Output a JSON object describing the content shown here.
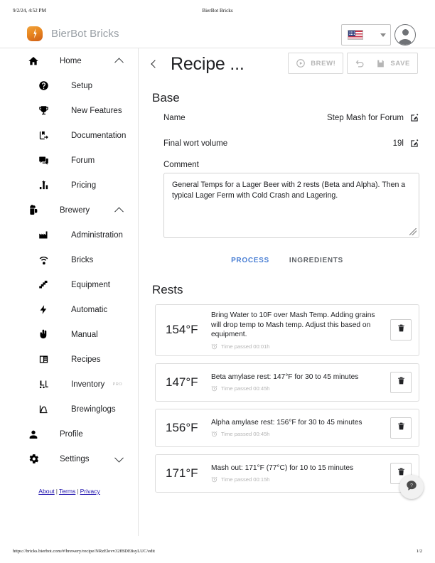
{
  "print": {
    "date": "9/2/24, 4:52 PM",
    "doc_title": "BierBot Bricks",
    "url": "https://bricks.bierbot.com/#/brewery/recipe/NRzElovv32fBDE8syLUC/edit",
    "page_number": "1/2"
  },
  "appbar": {
    "brand": "BierBot Bricks",
    "logo_icon": "bierbot-jug-bolt-icon",
    "language_flag": "us-flag-icon",
    "language_caret": "chevron-down-icon",
    "account_icon": "account-circle-icon"
  },
  "sidebar": {
    "groups": [
      {
        "label": "Home",
        "icon": "home-icon",
        "expanded_icon": "chevron-up-icon",
        "items": [
          {
            "label": "Setup",
            "icon": "help-circle-icon"
          },
          {
            "label": "New Features",
            "icon": "trophy-icon"
          },
          {
            "label": "Documentation",
            "icon": "book-import-icon"
          },
          {
            "label": "Forum",
            "icon": "forum-icon"
          },
          {
            "label": "Pricing",
            "icon": "bar-chart-icon"
          }
        ]
      },
      {
        "label": "Brewery",
        "icon": "beer-mug-icon",
        "expanded_icon": "chevron-up-icon",
        "items": [
          {
            "label": "Administration",
            "icon": "factory-icon"
          },
          {
            "label": "Bricks",
            "icon": "wifi-settings-icon"
          },
          {
            "label": "Equipment",
            "icon": "equipment-icon"
          },
          {
            "label": "Automatic",
            "icon": "lightning-bolt-icon"
          },
          {
            "label": "Manual",
            "icon": "hand-icon"
          },
          {
            "label": "Recipes",
            "icon": "recipe-book-icon"
          },
          {
            "label": "Inventory",
            "icon": "forklift-icon",
            "badge": "PRO"
          },
          {
            "label": "Brewinglogs",
            "icon": "curve-chart-icon"
          }
        ]
      }
    ],
    "profile": {
      "label": "Profile",
      "icon": "person-icon"
    },
    "settings": {
      "label": "Settings",
      "icon": "gear-icon",
      "collapsed_icon": "chevron-down-icon"
    },
    "footer_links": [
      {
        "label": "About"
      },
      {
        "label": "Terms"
      },
      {
        "label": "Privacy"
      }
    ],
    "footer_separator": "|"
  },
  "main": {
    "back_icon": "chevron-left-icon",
    "title": "Recipe ...",
    "toolbar": {
      "brew_label": "BREW!",
      "brew_icon": "play-circle-icon",
      "undo_icon": "undo-icon",
      "save_label": "SAVE",
      "save_icon": "floppy-disk-icon"
    },
    "base_section": {
      "heading": "Base",
      "fields": [
        {
          "label": "Name",
          "value": "Step Mash for Forum",
          "edit_icon": "edit-pencil-icon"
        },
        {
          "label": "Final wort volume",
          "value": "19l",
          "edit_icon": "edit-pencil-icon"
        }
      ],
      "comment_label": "Comment",
      "comment_value": "General Temps for a Lager Beer with 2 rests (Beta and Alpha).  Then a typical Lager Ferm with Cold Crash and Lagering.",
      "resize_handle_icon": "resize-grip-icon"
    },
    "tabs": [
      {
        "label": "PROCESS",
        "active": true
      },
      {
        "label": "INGREDIENTS",
        "active": false
      }
    ],
    "rests_heading": "Rests",
    "rests": [
      {
        "temperature": "154°F",
        "description": "Bring Water to 10F over Mash Temp. Adding grains will drop temp to Mash temp. Adjust this based on equipment.",
        "time_icon": "alarm-clock-icon",
        "time_text": "Time passed 00:01h",
        "delete_icon": "trash-icon"
      },
      {
        "temperature": "147°F",
        "description": "Beta amylase rest: 147°F for 30 to 45 minutes",
        "time_icon": "alarm-clock-icon",
        "time_text": "Time passed 00:45h",
        "delete_icon": "trash-icon"
      },
      {
        "temperature": "156°F",
        "description": "Alpha amylase rest: 156°F for 30 to 45 minutes",
        "time_icon": "alarm-clock-icon",
        "time_text": "Time passed 00:45h",
        "delete_icon": "trash-icon"
      },
      {
        "temperature": "171°F",
        "description": "Mash out: 171°F (77°C) for 10 to 15 minutes",
        "time_icon": "alarm-clock-icon",
        "time_text": "Time passed 00:15h",
        "delete_icon": "trash-icon"
      }
    ],
    "support_fab_icon": "chat-bubble-help-icon"
  },
  "colors": {
    "accent_blue": "#4a7fd4",
    "link_blue": "#1a0dab",
    "brand_grey": "#9aa0a6",
    "logo_orange": "#e8861f",
    "muted_grey": "#b4b4b4"
  }
}
